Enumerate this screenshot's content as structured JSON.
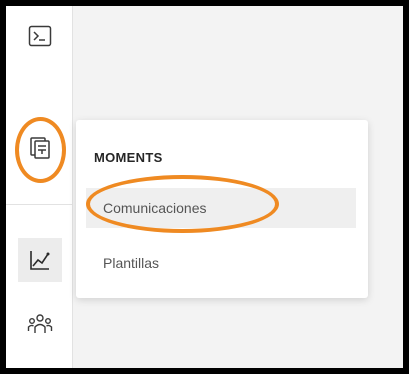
{
  "sidebar": {
    "items": [
      {
        "icon": "terminal-icon"
      },
      {
        "icon": "moments-icon",
        "annotated": true
      },
      {
        "icon": "analytics-chart-icon",
        "active": true
      },
      {
        "icon": "people-group-icon"
      }
    ]
  },
  "menu": {
    "heading": "MOMENTS",
    "items": [
      {
        "label": "Comunicaciones",
        "selected": true,
        "annotated": true
      },
      {
        "label": "Plantillas",
        "selected": false
      }
    ]
  },
  "annotations": {
    "color": "#ef8a22",
    "shape": "ellipse"
  },
  "colors": {
    "border": "#000000",
    "background": "#f3f3f3",
    "sidebar": "#ffffff",
    "icon": "#3a3a3a"
  }
}
